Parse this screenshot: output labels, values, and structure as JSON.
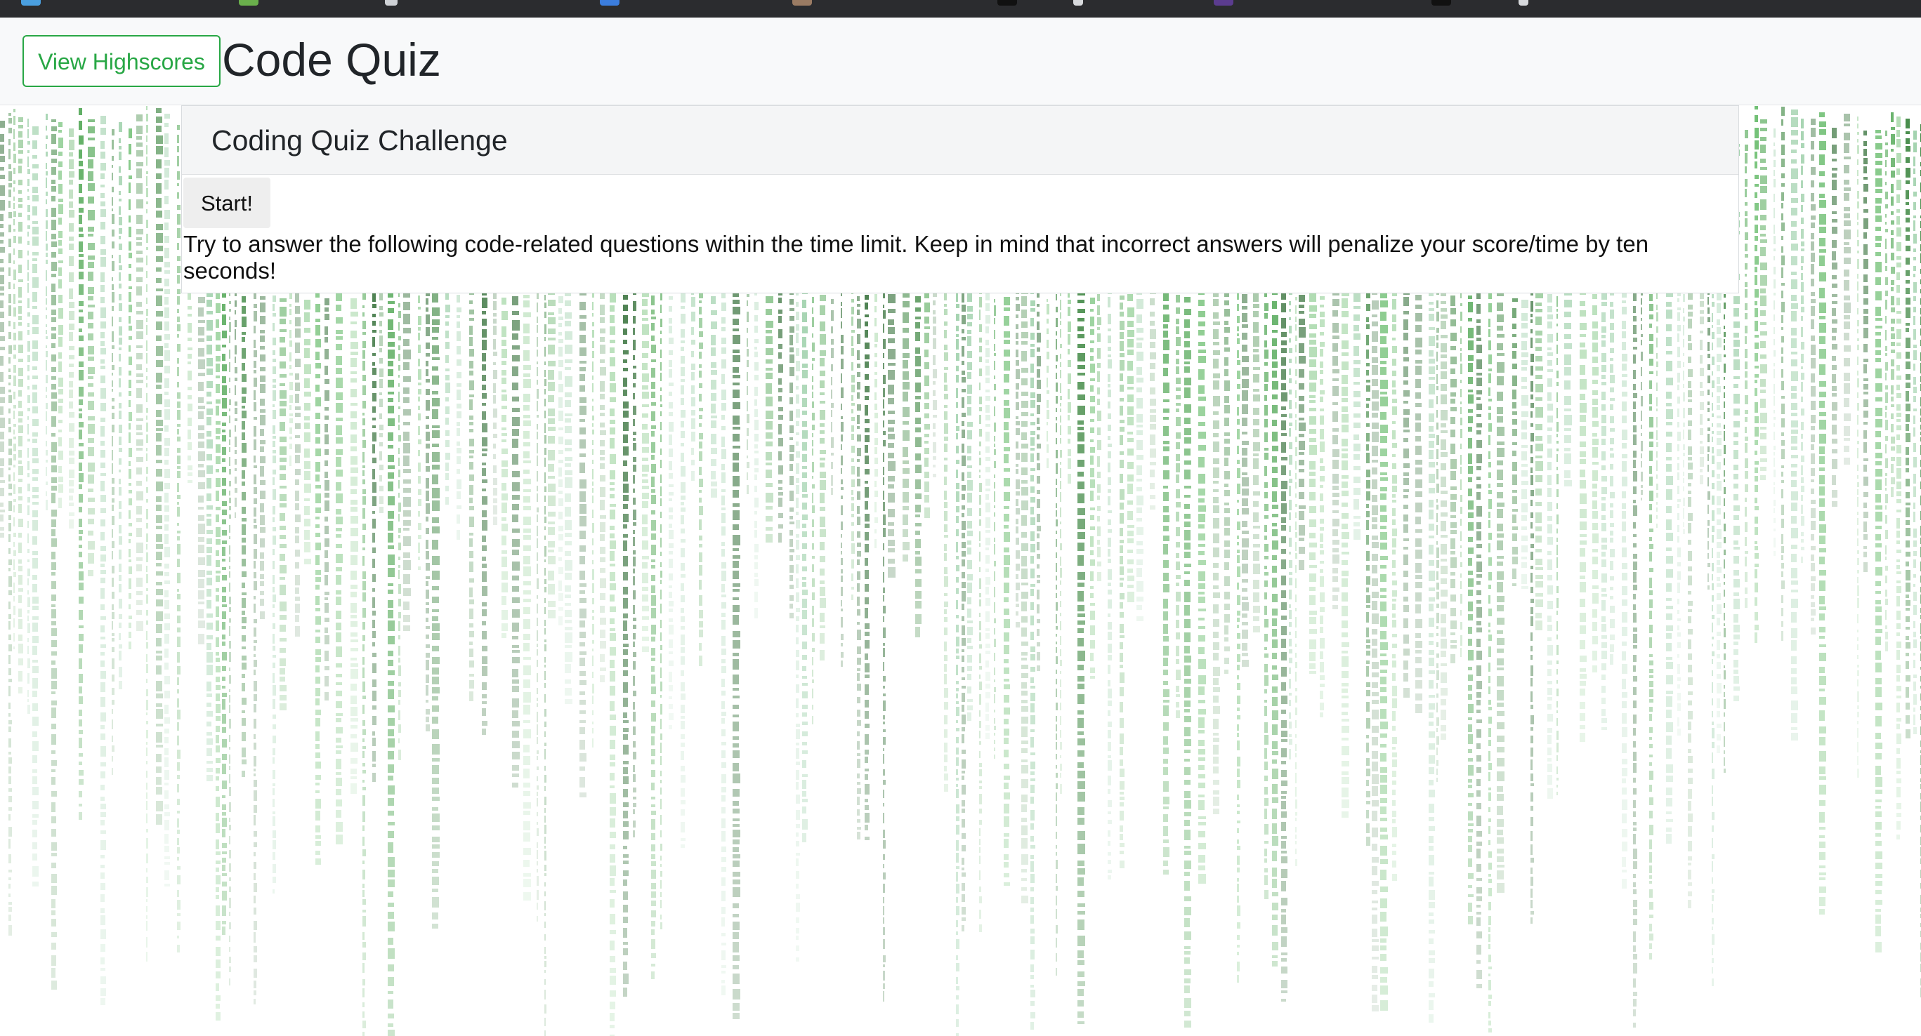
{
  "header": {
    "highscores_label": "View Highscores",
    "title": "Code Quiz"
  },
  "card": {
    "title": "Coding Quiz Challenge",
    "start_label": "Start!",
    "intro": "Try to answer the following code-related questions within the time limit. Keep in mind that incorrect answers will penalize your score/time by ten seconds!"
  },
  "theme": {
    "accent": "#28a745",
    "rain_colors": [
      "#2e7d32",
      "#43a047",
      "#1b5e20",
      "#66bb6a",
      "#8bc79a"
    ]
  }
}
